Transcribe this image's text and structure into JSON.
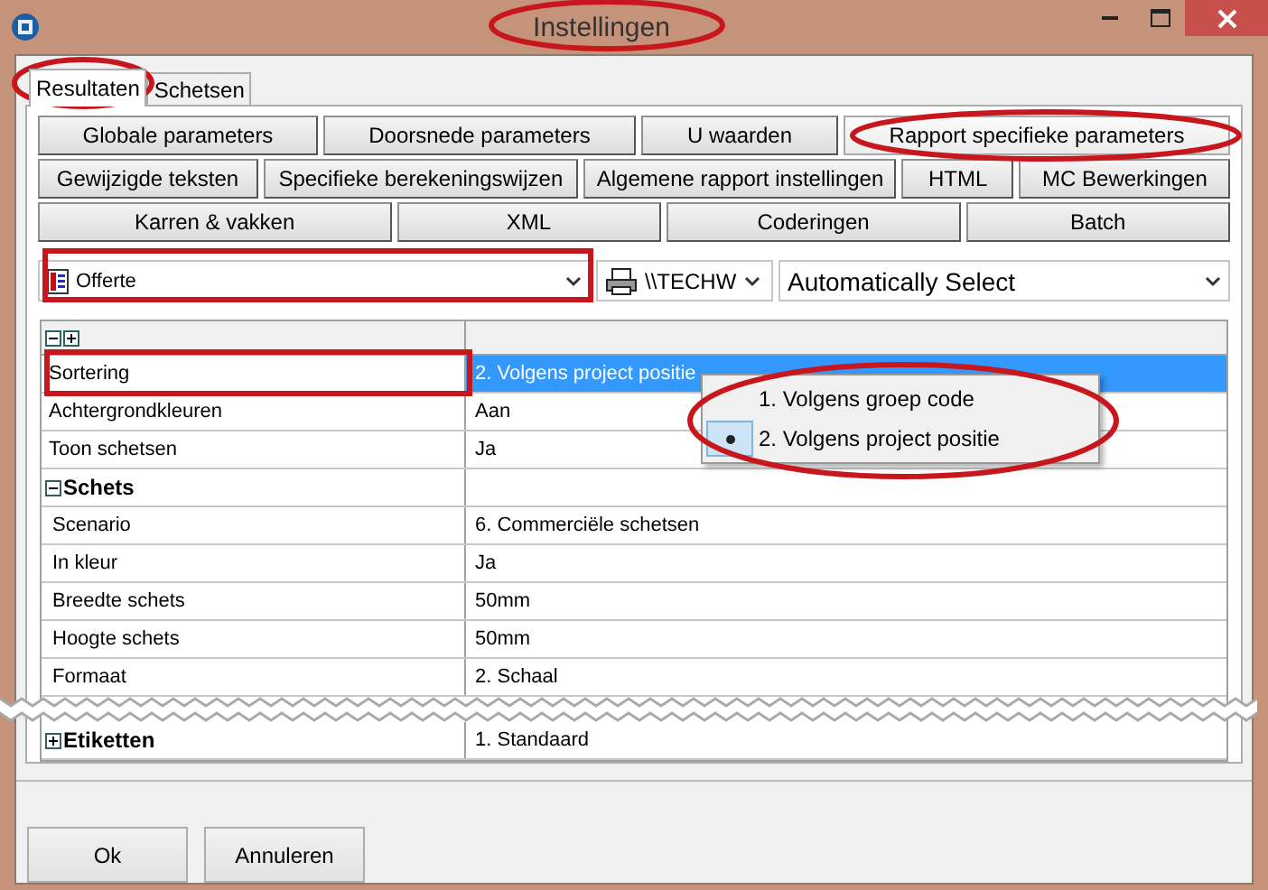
{
  "window": {
    "title": "Instellingen"
  },
  "tabs": [
    {
      "label": "Resultaten",
      "selected": true
    },
    {
      "label": "Schetsen",
      "selected": false
    }
  ],
  "button_rows": [
    [
      {
        "label": "Globale parameters",
        "selected": false
      },
      {
        "label": "Doorsnede parameters",
        "selected": false
      },
      {
        "label": "U waarden",
        "selected": false
      },
      {
        "label": "Rapport specifieke parameters",
        "selected": true
      }
    ],
    [
      {
        "label": "Gewijzigde teksten",
        "selected": false
      },
      {
        "label": "Specifieke berekeningswijzen",
        "selected": false
      },
      {
        "label": "Algemene rapport instellingen",
        "selected": false
      },
      {
        "label": "HTML",
        "selected": false
      },
      {
        "label": "MC Bewerkingen",
        "selected": false
      }
    ],
    [
      {
        "label": "Karren & vakken",
        "selected": false
      },
      {
        "label": "XML",
        "selected": false
      },
      {
        "label": "Coderingen",
        "selected": false
      },
      {
        "label": "Batch",
        "selected": false
      }
    ]
  ],
  "report_combo": {
    "value": "Offerte"
  },
  "printer_combo": {
    "value": "\\\\TECHW"
  },
  "paper_combo": {
    "value": "Automatically Select"
  },
  "grid": {
    "rows": [
      {
        "kind": "property",
        "label": "Sortering",
        "value": "2. Volgens project positie",
        "selected": true
      },
      {
        "kind": "property",
        "label": "Achtergrondkleuren",
        "value": "Aan",
        "selected": false
      },
      {
        "kind": "property",
        "label": "Toon schetsen",
        "value": "Ja",
        "selected": false
      },
      {
        "kind": "group",
        "label": "Schets",
        "expanded": true,
        "children": [
          {
            "kind": "property",
            "label": "Scenario",
            "value": "6. Commerciële schetsen",
            "selected": false
          },
          {
            "kind": "property",
            "label": "In kleur",
            "value": "Ja",
            "selected": false
          },
          {
            "kind": "property",
            "label": "Breedte schets",
            "value": "50mm",
            "selected": false
          },
          {
            "kind": "property",
            "label": "Hoogte schets",
            "value": "50mm",
            "selected": false
          },
          {
            "kind": "property",
            "label": "Formaat",
            "value": "2. Schaal",
            "selected": false
          }
        ]
      },
      {
        "kind": "group",
        "label": "Etiketten",
        "expanded": false,
        "value": "1. Standaard"
      }
    ]
  },
  "popup_menu": {
    "items": [
      {
        "label": "1. Volgens groep code",
        "selected": false
      },
      {
        "label": "2. Volgens project positie",
        "selected": true
      }
    ]
  },
  "footer_buttons": [
    {
      "label": "Ok"
    },
    {
      "label": "Annuleren"
    }
  ]
}
